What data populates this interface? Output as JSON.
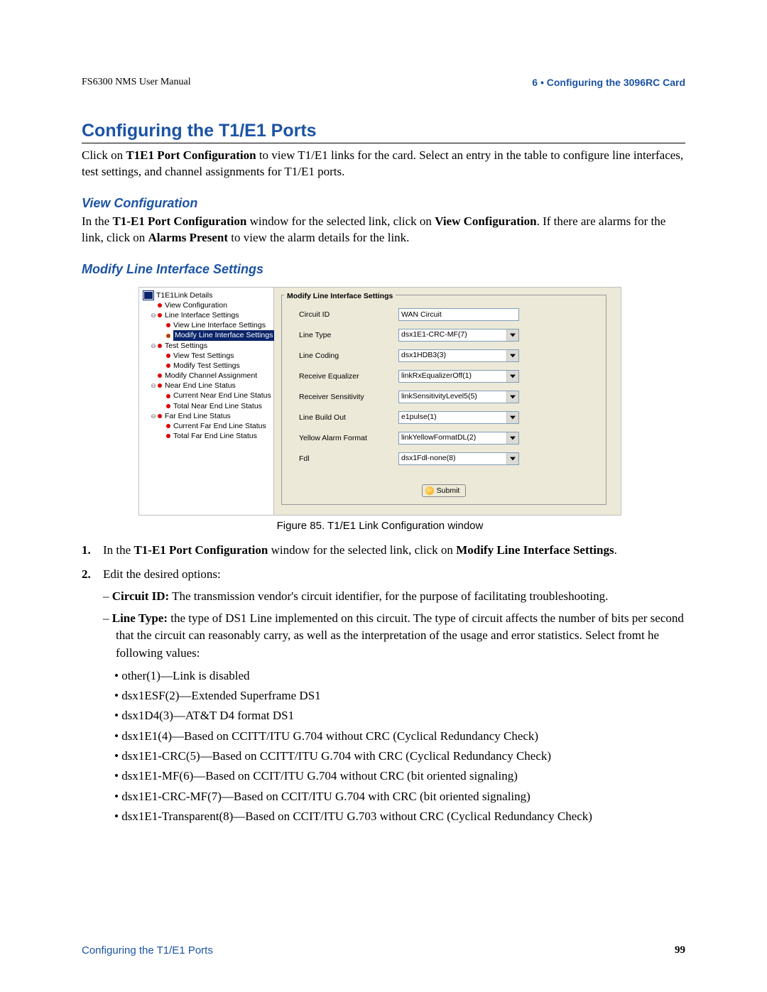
{
  "header": {
    "left": "FS6300 NMS User Manual",
    "right": "6 • Configuring the 3096RC Card"
  },
  "title": "Configuring the T1/E1 Ports",
  "intro_pre": "Click on ",
  "intro_bold": "T1E1 Port Configuration",
  "intro_post": " to view T1/E1 links for the card. Select an entry in the table to configure line interfaces, test settings, and channel assignments for T1/E1 ports.",
  "sections": {
    "view": {
      "heading": "View Configuration",
      "p1a": "In the ",
      "p1b": "T1-E1 Port Configuration",
      "p1c": " window for the selected link, click on ",
      "p1d": "View Configuration",
      "p1e": ". If there are alarms for the link, click on ",
      "p1f": "Alarms Present",
      "p1g": " to view the alarm details for the link."
    },
    "modify": {
      "heading": "Modify Line Interface Settings"
    }
  },
  "tree": {
    "root": "T1E1Link Details",
    "items": [
      {
        "indent": 1,
        "label": "View Configuration"
      },
      {
        "indent": 1,
        "label": "Line Interface Settings",
        "key": "-"
      },
      {
        "indent": 2,
        "label": "View Line Interface Settings"
      },
      {
        "indent": 2,
        "label": "Modify Line Interface Settings",
        "selected": true
      },
      {
        "indent": 1,
        "label": "Test Settings",
        "key": "-"
      },
      {
        "indent": 2,
        "label": "View Test Settings"
      },
      {
        "indent": 2,
        "label": "Modify Test Settings"
      },
      {
        "indent": 1,
        "label": "Modify Channel Assignment"
      },
      {
        "indent": 1,
        "label": "Near End Line Status",
        "key": "-"
      },
      {
        "indent": 2,
        "label": "Current Near End Line Status"
      },
      {
        "indent": 2,
        "label": "Total Near End Line Status"
      },
      {
        "indent": 1,
        "label": "Far End Line Status",
        "key": "-"
      },
      {
        "indent": 2,
        "label": "Current Far End Line Status"
      },
      {
        "indent": 2,
        "label": "Total Far End Line Status"
      }
    ]
  },
  "form": {
    "legend": "Modify Line Interface Settings",
    "fields": [
      {
        "label": "Circuit ID",
        "type": "text",
        "value": "WAN Circuit"
      },
      {
        "label": "Line Type",
        "type": "select",
        "value": "dsx1E1-CRC-MF(7)"
      },
      {
        "label": "Line Coding",
        "type": "select",
        "value": "dsx1HDB3(3)"
      },
      {
        "label": "Receive Equalizer",
        "type": "select",
        "value": "linkRxEqualizerOff(1)"
      },
      {
        "label": "Receiver Sensitivity",
        "type": "select",
        "value": "linkSensitivityLevel5(5)"
      },
      {
        "label": "Line Build Out",
        "type": "select",
        "value": "e1pulse(1)"
      },
      {
        "label": "Yellow Alarm Format",
        "type": "select",
        "value": "linkYellowFormatDL(2)"
      },
      {
        "label": "Fdl",
        "type": "select",
        "value": "dsx1Fdl-none(8)"
      }
    ],
    "submit": "Submit"
  },
  "caption": "Figure 85. T1/E1 Link Configuration window",
  "steps": {
    "s1a": "In the ",
    "s1b": "T1-E1 Port Configuration",
    "s1c": " window for the selected link, click on ",
    "s1d": "Modify Line Interface Settings",
    "s1e": ".",
    "s2": "Edit the desired options:",
    "dash": [
      {
        "bold": "Circuit ID:",
        "rest": " The transmission vendor's circuit identifier, for the purpose of facilitating troubleshooting."
      },
      {
        "bold": "Line Type:",
        "rest": " the type of DS1 Line implemented on this circuit. The type of circuit affects the number of bits per second that the circuit can reasonably carry, as well as the interpretation of the usage and error statistics. Select fromt he following values:"
      }
    ],
    "bullets": [
      "other(1)—Link is disabled",
      "dsx1ESF(2)—Extended Superframe DS1",
      "dsx1D4(3)—AT&T D4 format DS1",
      "dsx1E1(4)—Based on CCITT/ITU G.704 without CRC (Cyclical Redundancy Check)",
      "dsx1E1-CRC(5)—Based on CCITT/ITU G.704 with CRC (Cyclical Redundancy Check)",
      "dsx1E1-MF(6)—Based on CCIT/ITU G.704 without CRC (bit oriented signaling)",
      "dsx1E1-CRC-MF(7)—Based on CCIT/ITU G.704 with CRC (bit oriented signaling)",
      "dsx1E1-Transparent(8)—Based on CCIT/ITU G.703 without CRC (Cyclical Redundancy Check)"
    ]
  },
  "footer": {
    "left": "Configuring the T1/E1 Ports",
    "right": "99"
  }
}
